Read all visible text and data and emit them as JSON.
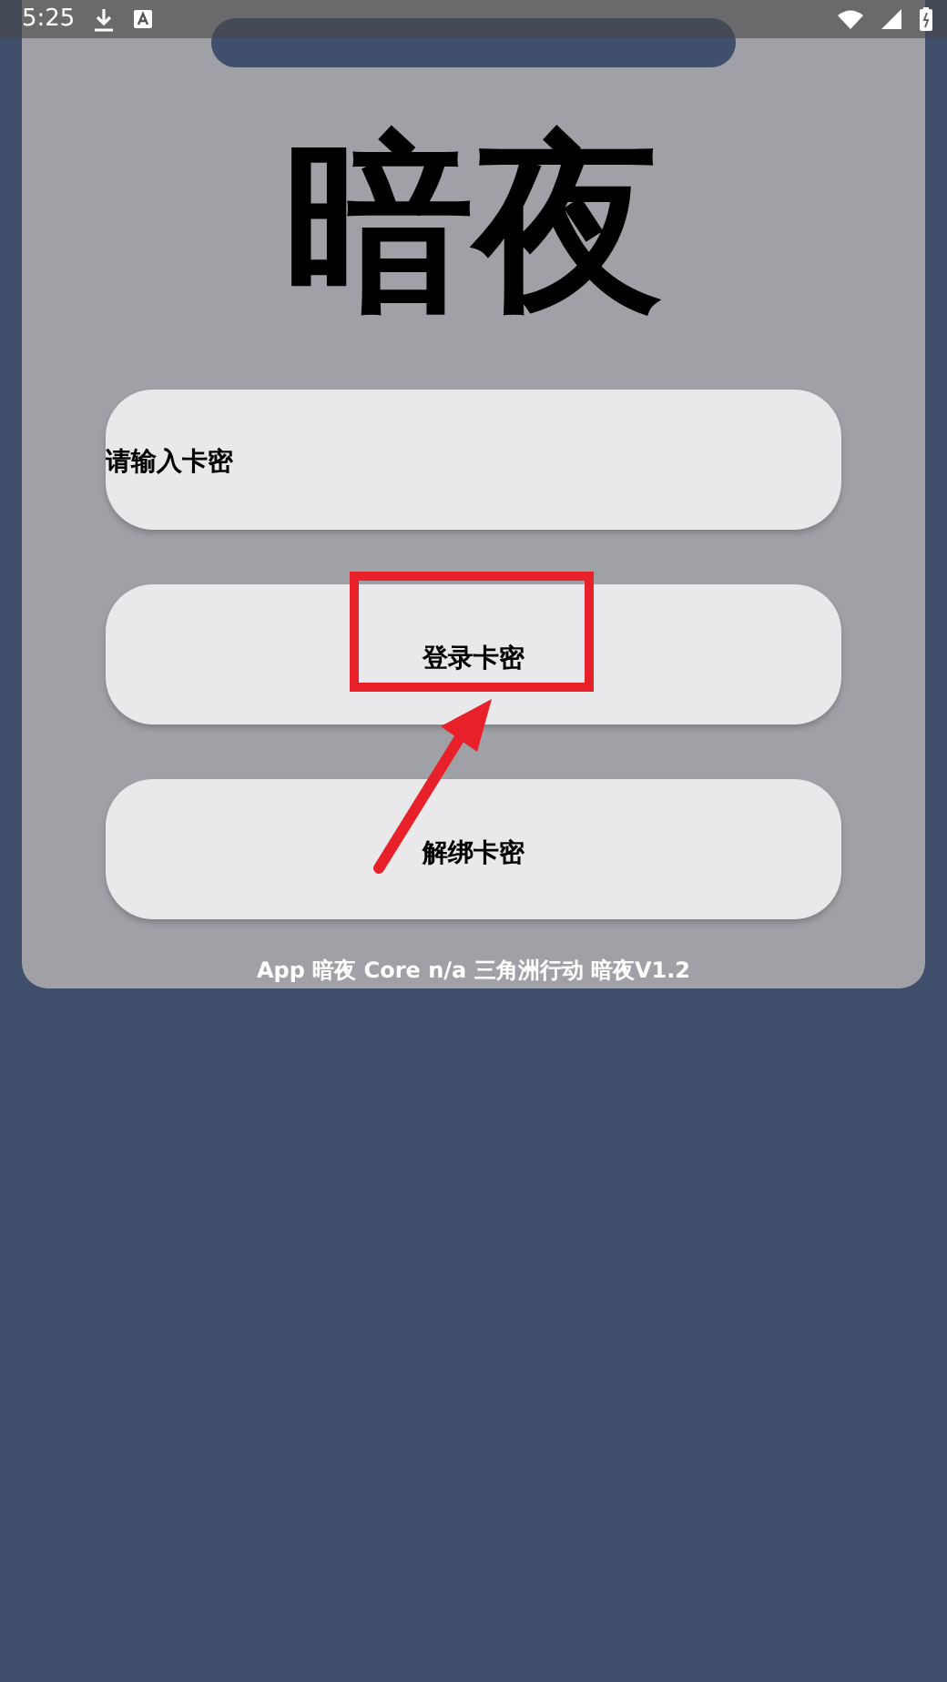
{
  "status_bar": {
    "time": "5:25"
  },
  "title": "暗夜",
  "card_input": {
    "placeholder": "请输入卡密"
  },
  "buttons": [
    {
      "label": "登录卡密",
      "highlighted": true
    },
    {
      "label": "解绑卡密",
      "highlighted": false
    }
  ],
  "footer": "App 暗夜 Core n/a 三角洲行动 暗夜V1.2"
}
